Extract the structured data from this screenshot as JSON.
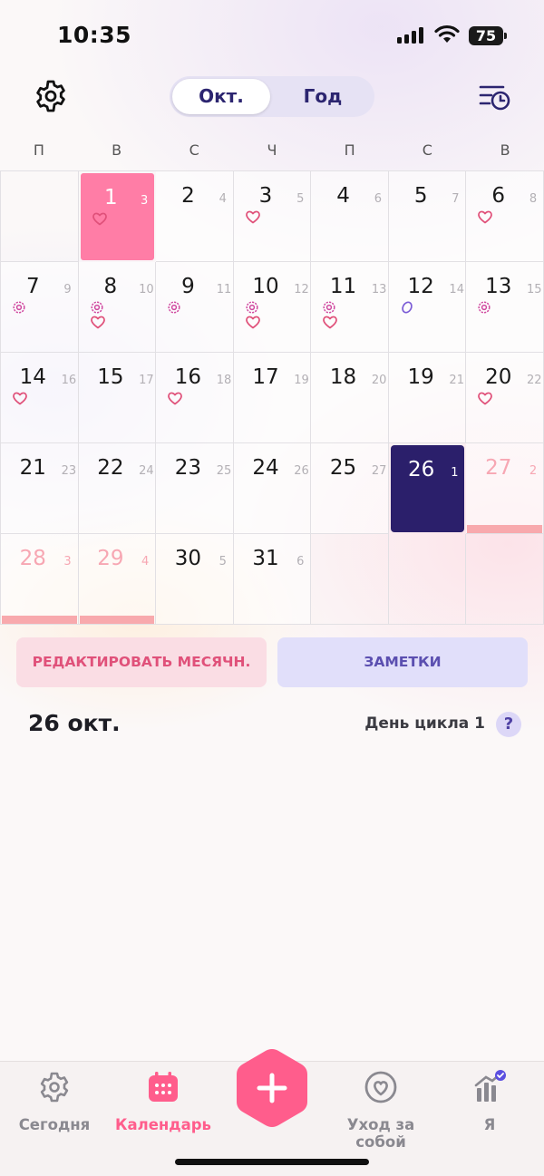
{
  "status_bar": {
    "time": "10:35",
    "battery": "75"
  },
  "top_bar": {
    "settings_icon": "gear-icon",
    "view_toggle": {
      "active": "Окт.",
      "inactive": "Год"
    },
    "history_icon": "history-clock-icon"
  },
  "weekdays": [
    "П",
    "В",
    "С",
    "Ч",
    "П",
    "С",
    "В"
  ],
  "calendar": {
    "rows": [
      [
        {
          "empty": true
        },
        {
          "day": "1",
          "cycle": "3",
          "state": "period-selected",
          "icons": [
            "heart"
          ]
        },
        {
          "day": "2",
          "cycle": "4"
        },
        {
          "day": "3",
          "cycle": "5",
          "icons": [
            "heart"
          ]
        },
        {
          "day": "4",
          "cycle": "6"
        },
        {
          "day": "5",
          "cycle": "7"
        },
        {
          "day": "6",
          "cycle": "8",
          "icons": [
            "heart"
          ]
        }
      ],
      [
        {
          "day": "7",
          "cycle": "9",
          "icons": [
            "flower"
          ]
        },
        {
          "day": "8",
          "cycle": "10",
          "icons": [
            "flower",
            "heart"
          ]
        },
        {
          "day": "9",
          "cycle": "11",
          "icons": [
            "flower"
          ]
        },
        {
          "day": "10",
          "cycle": "12",
          "icons": [
            "flower",
            "heart"
          ]
        },
        {
          "day": "11",
          "cycle": "13",
          "icons": [
            "flower",
            "heart"
          ]
        },
        {
          "day": "12",
          "cycle": "14",
          "icons": [
            "ovulation"
          ]
        },
        {
          "day": "13",
          "cycle": "15",
          "icons": [
            "flower"
          ]
        }
      ],
      [
        {
          "day": "14",
          "cycle": "16",
          "icons": [
            "heart"
          ]
        },
        {
          "day": "15",
          "cycle": "17"
        },
        {
          "day": "16",
          "cycle": "18",
          "icons": [
            "heart"
          ]
        },
        {
          "day": "17",
          "cycle": "19"
        },
        {
          "day": "18",
          "cycle": "20"
        },
        {
          "day": "19",
          "cycle": "21"
        },
        {
          "day": "20",
          "cycle": "22",
          "icons": [
            "heart"
          ]
        }
      ],
      [
        {
          "day": "21",
          "cycle": "23"
        },
        {
          "day": "22",
          "cycle": "24"
        },
        {
          "day": "23",
          "cycle": "25"
        },
        {
          "day": "24",
          "cycle": "26"
        },
        {
          "day": "25",
          "cycle": "27"
        },
        {
          "day": "26",
          "cycle": "1",
          "state": "today"
        },
        {
          "day": "27",
          "cycle": "2",
          "state": "predicted"
        }
      ],
      [
        {
          "day": "28",
          "cycle": "3",
          "state": "predicted"
        },
        {
          "day": "29",
          "cycle": "4",
          "state": "predicted"
        },
        {
          "day": "30",
          "cycle": "5"
        },
        {
          "day": "31",
          "cycle": "6"
        },
        {
          "empty": true
        },
        {
          "empty": true
        },
        {
          "empty": true
        }
      ]
    ]
  },
  "actions": {
    "edit_period": "РЕДАКТИРОВАТЬ МЕСЯЧН.",
    "notes": "ЗАМЕТКИ"
  },
  "selected_day": {
    "title": "26 окт.",
    "cycle_day_label": "День цикла 1",
    "help": "?"
  },
  "bottom_nav": {
    "items": [
      {
        "label": "Сегодня",
        "icon": "gear-flower-icon"
      },
      {
        "label": "Календарь",
        "icon": "calendar-icon",
        "active": true
      },
      {
        "label": "Уход за собой",
        "icon": "self-care-heart-icon"
      },
      {
        "label": "Я",
        "icon": "profile-chart-icon"
      }
    ],
    "add_icon": "plus-icon"
  },
  "colors": {
    "accent_pink": "#ff5d8c",
    "period_pink": "#ff7da6",
    "today_navy": "#2b1f6b",
    "notes_purple": "#5b4fb0"
  }
}
